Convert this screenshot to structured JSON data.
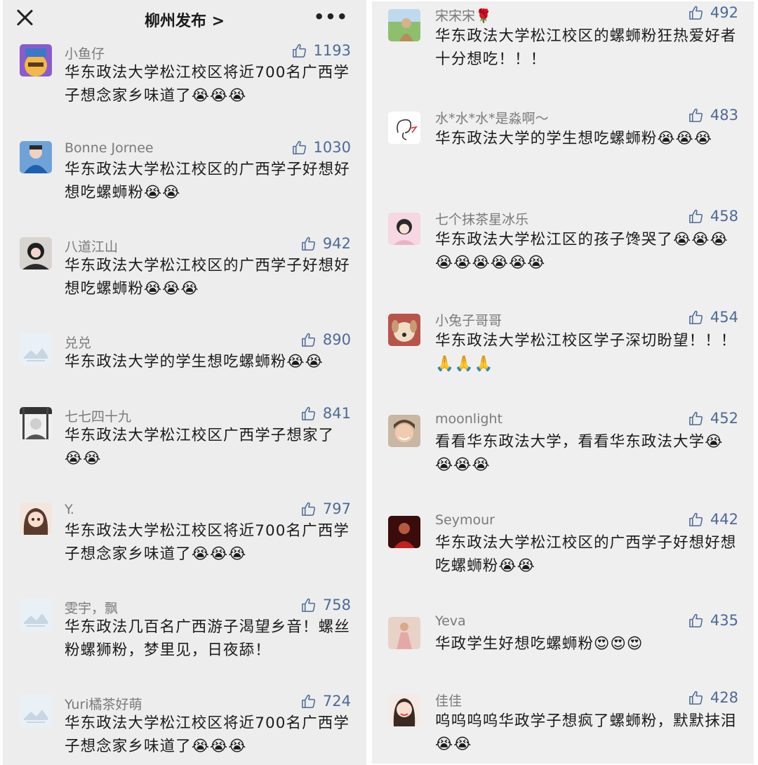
{
  "header": {
    "title": "柳州发布 >",
    "close_icon": "close-icon",
    "more_icon": "more-icon"
  },
  "left_comments": [
    {
      "name": "小鱼仔",
      "likes": "1193",
      "text": "华东政法大学松江校区将近700名广西学子想念家乡味道了😭😭😭",
      "avatar": "cartoon"
    },
    {
      "name": "Bonne Jornee",
      "likes": "1030",
      "text": "华东政法大学松江校区的广西学子好想好想吃螺蛳粉😭😭",
      "avatar": "photo-blue"
    },
    {
      "name": "八道江山",
      "likes": "942",
      "text": "华东政法大学松江校区的广西学子好想好想吃螺蛳粉😭😭😭",
      "avatar": "photo-dark"
    },
    {
      "name": "兑兑",
      "likes": "890",
      "text": "华东政法大学的学生想吃螺蛳粉😭😭",
      "avatar": "placeholder"
    },
    {
      "name": "七七四十九",
      "likes": "841",
      "text": "华东政法大学松江校区广西学子想家了😭😭",
      "avatar": "sketch"
    },
    {
      "name": "Y.",
      "likes": "797",
      "text": "华东政法大学松江校区将近700名广西学子想念家乡味道了😭😭😭",
      "avatar": "anime"
    },
    {
      "name": "雯宇，飘",
      "likes": "758",
      "text": "华东政法几百名广西游子渴望乡音！螺丝粉螺狮粉，梦里见，日夜舔！",
      "avatar": "placeholder"
    },
    {
      "name": "Yuri橘茶好萌",
      "likes": "724",
      "text": "华东政法大学松江校区将近700名广西学子想念家乡味道了😭😭😭",
      "avatar": "placeholder"
    }
  ],
  "right_comments": [
    {
      "name": "宋宋宋🌹",
      "likes": "492",
      "text": "华东政法大学松江校区的螺蛳粉狂热爱好者十分想吃！！！",
      "avatar": "outdoor"
    },
    {
      "name": "水*水*水*是淼啊～",
      "likes": "483",
      "text": "华东政法大学的学生想吃螺蛳粉😭😭😭",
      "avatar": "line-art"
    },
    {
      "name": "七个抹茶星冰乐",
      "likes": "458",
      "text": "华东政法大学松江区的孩子馋哭了😭😭😭😭😭😭😭😭😭",
      "avatar": "pink"
    },
    {
      "name": "小兔子哥哥",
      "likes": "454",
      "text": "华东政法大学松江校区学子深切盼望！！！🙏🙏🙏",
      "avatar": "dog"
    },
    {
      "name": "moonlight",
      "likes": "452",
      "text": "看看华东政法大学，看看华东政法大学😭😭😭😭",
      "avatar": "boy"
    },
    {
      "name": "Seymour",
      "likes": "442",
      "text": "华东政法大学松江校区的广西学子好想好想吃螺蛳粉😭😭",
      "avatar": "red-dark"
    },
    {
      "name": "Yeva",
      "likes": "435",
      "text": "华政学生好想吃螺蛳粉😍😍😍",
      "avatar": "dress"
    },
    {
      "name": "佳佳",
      "likes": "428",
      "text": "呜呜呜呜华政学子想疯了螺蛳粉，默默抹泪😭😭",
      "avatar": "girl"
    }
  ]
}
